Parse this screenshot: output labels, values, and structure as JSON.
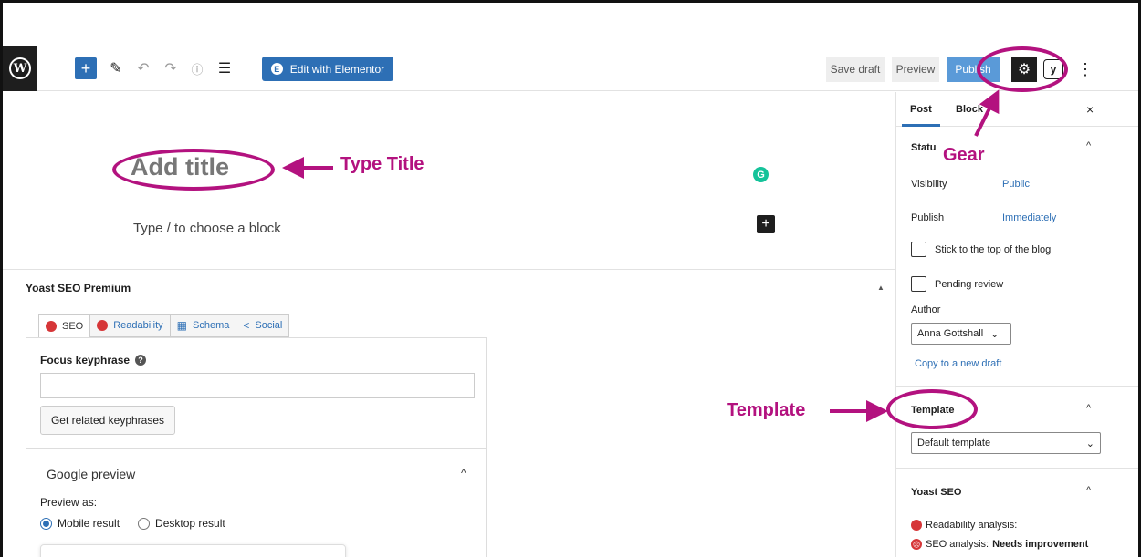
{
  "toolbar": {
    "wp_logo": "W",
    "add_icon": "+",
    "pen_icon": "✎",
    "undo_icon": "↶",
    "redo_icon": "↷",
    "info_icon": "ⓘ",
    "list_icon": "☰",
    "elementor_label": "Edit with Elementor",
    "elementor_icon": "E",
    "save_draft": "Save draft",
    "preview": "Preview",
    "publish": "Publish",
    "gear_icon": "⚙",
    "yoast_icon": "y",
    "more_icon": "⋮"
  },
  "editor": {
    "title_placeholder": "Add title",
    "block_placeholder": "Type / to choose a block",
    "grammarly_icon": "G",
    "add_block_icon": "+"
  },
  "yoast": {
    "heading": "Yoast SEO Premium",
    "collapse_icon": "▲",
    "tabs": [
      {
        "label": "SEO"
      },
      {
        "label": "Readability"
      },
      {
        "label": "Schema"
      },
      {
        "label": "Social"
      }
    ],
    "schema_icon": "▦",
    "social_icon": "<",
    "focus_keyphrase_label": "Focus keyphrase",
    "help_icon": "?",
    "related_button": "Get related keyphrases",
    "google_preview": "Google preview",
    "chevron_up": "^",
    "preview_as": "Preview as:",
    "mobile_result": "Mobile result",
    "desktop_result": "Desktop result"
  },
  "sidebar": {
    "tab_post": "Post",
    "tab_block": "Block",
    "close_icon": "×",
    "status_title": "Statu",
    "chevron_up": "^",
    "visibility_label": "Visibility",
    "visibility_value": "Public",
    "publish_label": "Publish",
    "publish_value": "Immediately",
    "sticky_label": "Stick to the top of the blog",
    "pending_label": "Pending review",
    "author_label": "Author",
    "author_value": "Anna Gottshall",
    "select_chevron": "⌄",
    "copy_draft": "Copy to a new draft",
    "template_title": "Template",
    "template_value": "Default template",
    "yoast_title": "Yoast SEO",
    "readability_analysis": "Readability analysis:",
    "seo_analysis_prefix": "SEO analysis: ",
    "seo_analysis_value": "Needs improvement"
  },
  "annotations": {
    "type_title": "Type Title",
    "gear": "Gear",
    "template": "Template",
    "color": "#b3127f"
  },
  "colors": {
    "accent": "#2d6fb5",
    "error": "#d63638",
    "grammarly": "#15c39a"
  }
}
